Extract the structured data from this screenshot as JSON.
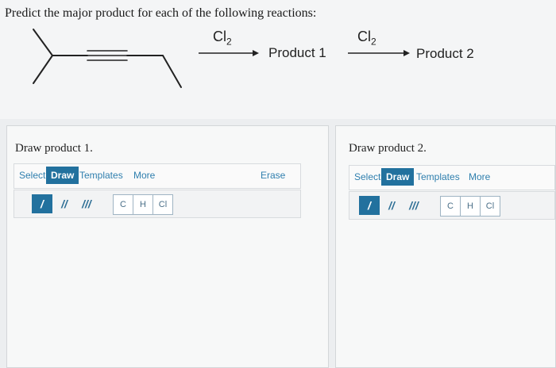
{
  "question": {
    "prompt": "Predict the major product for each of the following reactions:",
    "reagent1": "Cl",
    "reagent1_sub": "2",
    "product1": "Product 1",
    "reagent2": "Cl",
    "reagent2_sub": "2",
    "product2": "Product 2"
  },
  "panel1": {
    "title": "Draw product 1.",
    "toolbar": {
      "select": "Select",
      "draw": "Draw",
      "templates": "Templates",
      "more": "More",
      "erase": "Erase"
    },
    "bonds": [
      "/",
      "//",
      "///"
    ],
    "atoms": [
      "C",
      "H",
      "Cl"
    ]
  },
  "panel2": {
    "title": "Draw product 2.",
    "toolbar": {
      "select": "Select",
      "draw": "Draw",
      "templates": "Templates",
      "more": "More"
    },
    "bonds": [
      "/",
      "//",
      "///"
    ],
    "atoms": [
      "C",
      "H",
      "Cl"
    ]
  },
  "colors": {
    "accent": "#22719e",
    "link": "#2f7fae"
  },
  "icons": {
    "bond_single": "single-bond-icon",
    "bond_double": "double-bond-icon",
    "bond_triple": "triple-bond-icon"
  }
}
